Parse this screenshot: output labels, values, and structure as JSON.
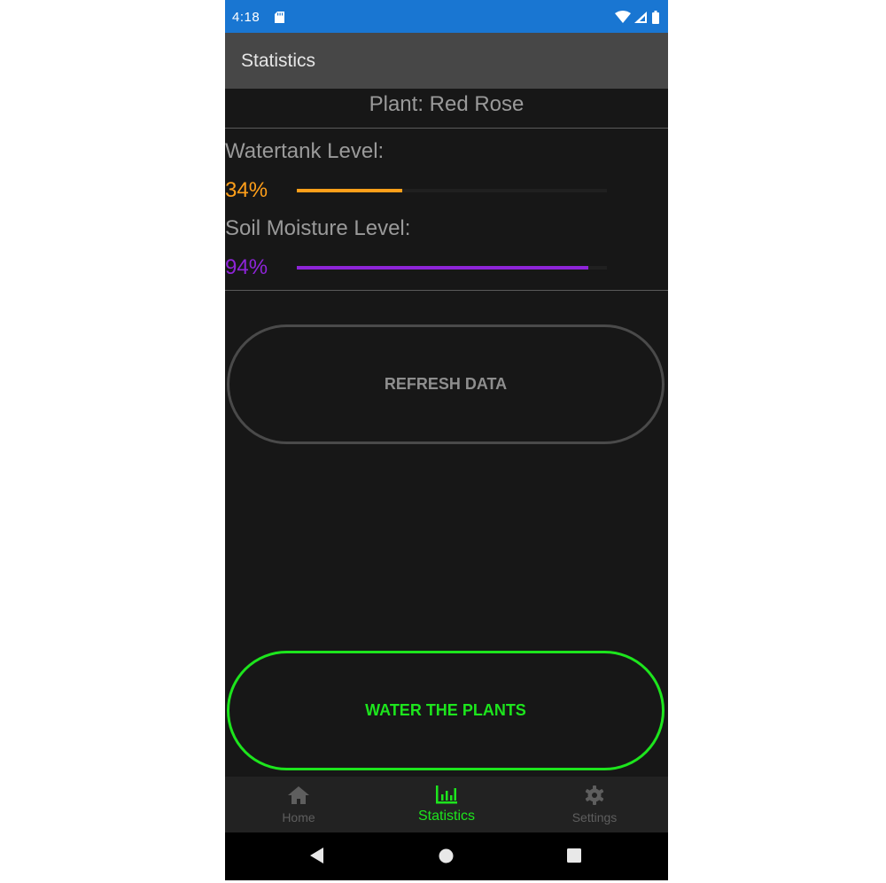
{
  "status_bar": {
    "time": "4:18",
    "icons": [
      "sd-card-icon",
      "wifi-icon",
      "signal-icon",
      "battery-icon"
    ]
  },
  "app_bar": {
    "title": "Statistics"
  },
  "plant": {
    "label": "Plant: Red Rose"
  },
  "metrics": [
    {
      "label": "Watertank Level:",
      "value_text": "34%",
      "value": 0.34,
      "color": "#ff9f1a"
    },
    {
      "label": "Soil Moisture Level:",
      "value_text": "94%",
      "value": 0.94,
      "color": "#8e24d8"
    }
  ],
  "buttons": {
    "refresh": "REFRESH DATA",
    "water": "WATER THE PLANTS"
  },
  "bottom_nav": {
    "items": [
      {
        "label": "Home",
        "icon": "home-icon",
        "active": false
      },
      {
        "label": "Statistics",
        "icon": "bar-chart-icon",
        "active": true
      },
      {
        "label": "Settings",
        "icon": "gear-icon",
        "active": false
      }
    ],
    "active_color": "#1de51d",
    "inactive_color": "#5e5e5e"
  },
  "colors": {
    "status_bar": "#1976d2",
    "app_bar": "#474747",
    "background": "#171717",
    "water_button": "#1de51d"
  }
}
